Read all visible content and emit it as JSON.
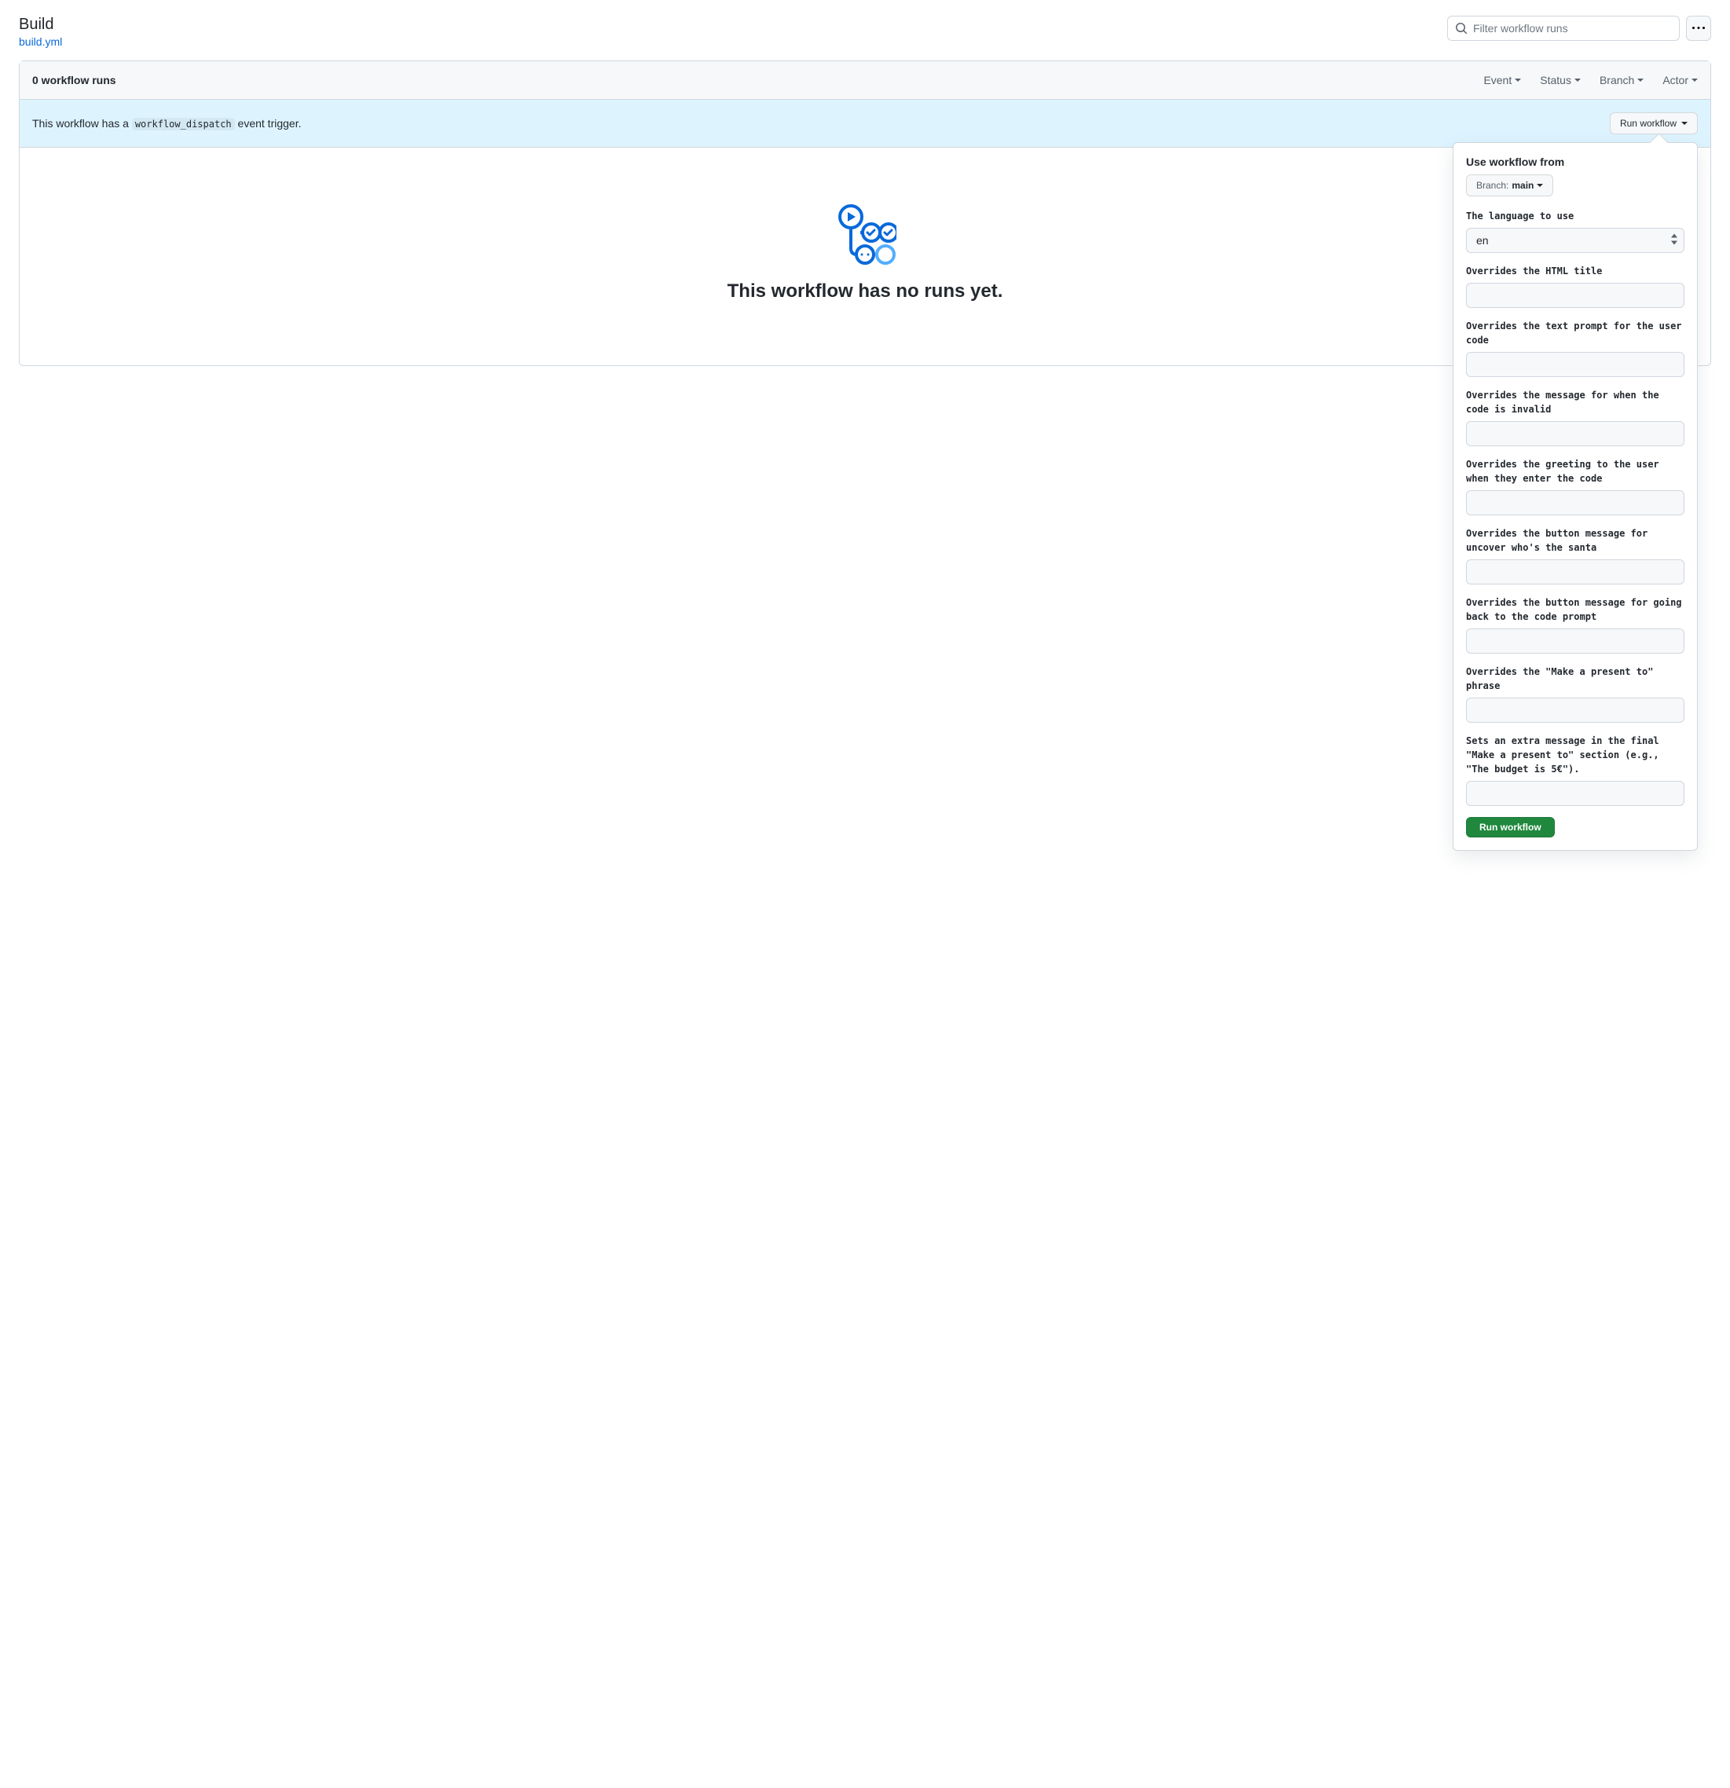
{
  "header": {
    "title": "Build",
    "file_link": "build.yml",
    "search_placeholder": "Filter workflow runs"
  },
  "panel": {
    "runs_count": "0 workflow runs",
    "filters": {
      "event": "Event",
      "status": "Status",
      "branch": "Branch",
      "actor": "Actor"
    }
  },
  "dispatch": {
    "prefix": "This workflow has a ",
    "code": "workflow_dispatch",
    "suffix": " event trigger.",
    "button": "Run workflow"
  },
  "empty": {
    "heading": "This workflow has no runs yet."
  },
  "popover": {
    "use_from": "Use workflow from",
    "branch_prefix": "Branch: ",
    "branch_value": "main",
    "fields": [
      {
        "label": "The language to use",
        "type": "select",
        "value": "en"
      },
      {
        "label": "Overrides the HTML title",
        "type": "text",
        "value": ""
      },
      {
        "label": "Overrides the text prompt for the user code",
        "type": "text",
        "value": ""
      },
      {
        "label": "Overrides the message for when the code is invalid",
        "type": "text",
        "value": ""
      },
      {
        "label": "Overrides the greeting to the user when they enter the code",
        "type": "text",
        "value": ""
      },
      {
        "label": "Overrides the button message for uncover who's the santa",
        "type": "text",
        "value": ""
      },
      {
        "label": "Overrides the button message for going back to the code prompt",
        "type": "text",
        "value": ""
      },
      {
        "label": "Overrides the \"Make a present to\" phrase",
        "type": "text",
        "value": ""
      },
      {
        "label": "Sets an extra message in the final \"Make a present to\" section (e.g., \"The budget is 5€\").",
        "type": "text",
        "value": ""
      }
    ],
    "submit": "Run workflow"
  }
}
